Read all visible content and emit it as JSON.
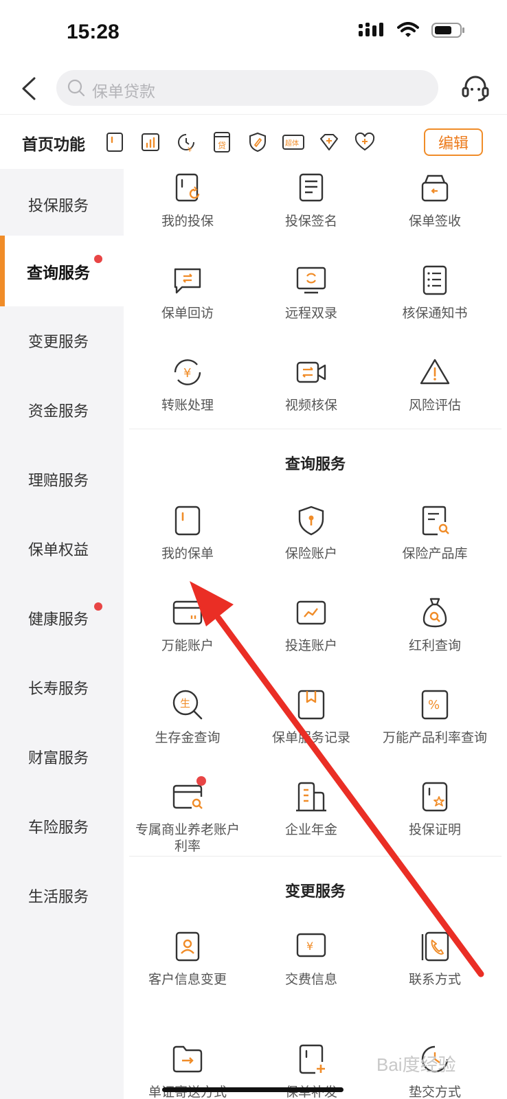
{
  "status_bar": {
    "time": "15:28"
  },
  "search": {
    "placeholder": "保单贷款"
  },
  "quick_bar": {
    "title": "首页功能",
    "edit_label": "编辑",
    "icons": [
      "policy-icon",
      "chart-icon",
      "transfer-clock-icon",
      "loan-icon",
      "shield-edit-icon",
      "super-body-icon",
      "diamond-plus-icon",
      "heart-plus-icon"
    ],
    "loan_char": "贷",
    "super_text": "超体"
  },
  "sidebar": {
    "items": [
      {
        "label": "投保服务"
      },
      {
        "label": "查询服务"
      },
      {
        "label": "变更服务"
      },
      {
        "label": "资金服务"
      },
      {
        "label": "理赔服务"
      },
      {
        "label": "保单权益"
      },
      {
        "label": "健康服务"
      },
      {
        "label": "长寿服务"
      },
      {
        "label": "财富服务"
      },
      {
        "label": "车险服务"
      },
      {
        "label": "生活服务"
      }
    ]
  },
  "insure_section": {
    "items": [
      {
        "label": "我的投保",
        "icon": "policy-refresh-icon"
      },
      {
        "label": "投保签名",
        "icon": "document-lines-icon"
      },
      {
        "label": "保单签收",
        "icon": "inbox-icon"
      },
      {
        "label": "保单回访",
        "icon": "chat-exchange-icon"
      },
      {
        "label": "远程双录",
        "icon": "monitor-sync-icon"
      },
      {
        "label": "核保通知书",
        "icon": "list-doc-icon"
      },
      {
        "label": "转账处理",
        "icon": "yuan-cycle-icon"
      },
      {
        "label": "视频核保",
        "icon": "video-exchange-icon"
      },
      {
        "label": "风险评估",
        "icon": "warning-icon"
      }
    ]
  },
  "query_section": {
    "title": "查询服务",
    "items": [
      {
        "label": "我的保单",
        "icon": "policy-icon"
      },
      {
        "label": "保险账户",
        "icon": "shield-key-icon"
      },
      {
        "label": "保险产品库",
        "icon": "doc-search-icon"
      },
      {
        "label": "万能账户",
        "icon": "card-icon"
      },
      {
        "label": "投连账户",
        "icon": "trend-icon"
      },
      {
        "label": "红利查询",
        "icon": "money-bag-search-icon"
      },
      {
        "label": "生存金查询",
        "icon": "magnifier-sheng-icon"
      },
      {
        "label": "保单服务记录",
        "icon": "bookmark-doc-icon"
      },
      {
        "label": "万能产品利率查询",
        "icon": "percent-doc-icon"
      },
      {
        "label": "专属商业养老账户\n利率",
        "icon": "card-search-icon"
      },
      {
        "label": "企业年金",
        "icon": "building-icon"
      },
      {
        "label": "投保证明",
        "icon": "policy-star-icon"
      }
    ],
    "sheng_char": "生"
  },
  "change_section": {
    "title": "变更服务",
    "items": [
      {
        "label": "客户信息变更",
        "icon": "contact-card-icon"
      },
      {
        "label": "交费信息",
        "icon": "yuan-box-icon"
      },
      {
        "label": "联系方式",
        "icon": "phone-book-icon"
      },
      {
        "label": "单证寄送方式",
        "icon": "folder-arrow-icon"
      },
      {
        "label": "保单补发",
        "icon": "policy-plus-icon"
      },
      {
        "label": "垫交方式",
        "icon": "clock-icon"
      }
    ]
  },
  "watermark": "Bai度经验",
  "accent_color": "#f08c28"
}
